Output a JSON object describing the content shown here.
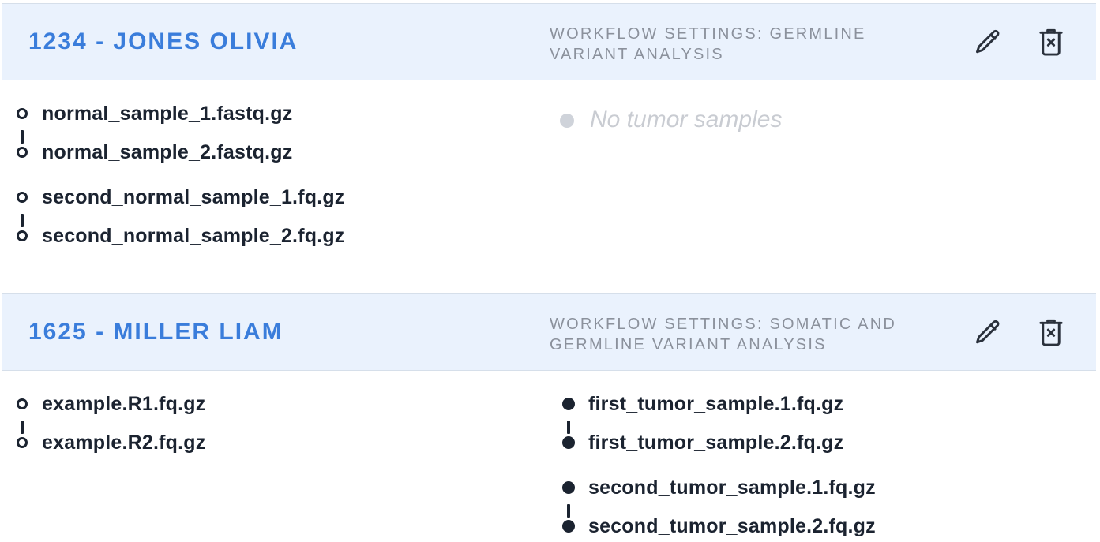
{
  "cases": [
    {
      "title": "1234 - JONES OLIVIA",
      "workflow": "WORKFLOW SETTINGS: GERMLINE VARIANT ANALYSIS",
      "normal_pairs": [
        [
          "normal_sample_1.fastq.gz",
          "normal_sample_2.fastq.gz"
        ],
        [
          "second_normal_sample_1.fq.gz",
          "second_normal_sample_2.fq.gz"
        ]
      ],
      "tumor_empty": "No tumor samples"
    },
    {
      "title": "1625 - MILLER LIAM",
      "workflow": "WORKFLOW SETTINGS: SOMATIC AND GERMLINE VARIANT ANALYSIS",
      "normal_pairs": [
        [
          "example.R1.fq.gz",
          "example.R2.fq.gz"
        ]
      ],
      "tumor_pairs": [
        [
          "first_tumor_sample.1.fq.gz",
          "first_tumor_sample.2.fq.gz"
        ],
        [
          "second_tumor_sample.1.fq.gz",
          "second_tumor_sample.2.fq.gz"
        ]
      ]
    }
  ],
  "icons": {
    "edit": "pencil-icon",
    "delete": "trash-x-icon"
  },
  "colors": {
    "header_bg": "#eaf2fd",
    "title": "#3a7ddb",
    "workflow_text": "#8b919c",
    "file_text": "#1b2330",
    "empty_text": "#c9ccd2"
  }
}
